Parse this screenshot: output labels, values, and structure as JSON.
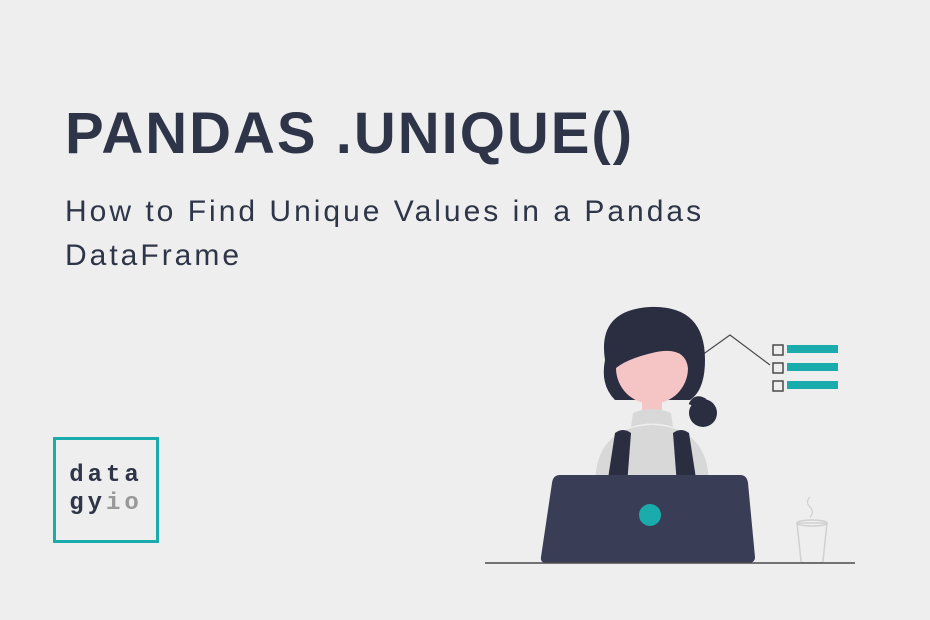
{
  "title": "PANDAS .UNIQUE()",
  "subtitle": "How to Find Unique Values in a Pandas DataFrame",
  "logo": {
    "line1": "data",
    "line2a": "gy",
    "line2b": "io"
  },
  "colors": {
    "bg": "#eeeeee",
    "dark": "#2e3548",
    "teal": "#1aacac",
    "grey": "#999999",
    "skin": "#f5c5c5",
    "light": "#e0e0e0"
  }
}
